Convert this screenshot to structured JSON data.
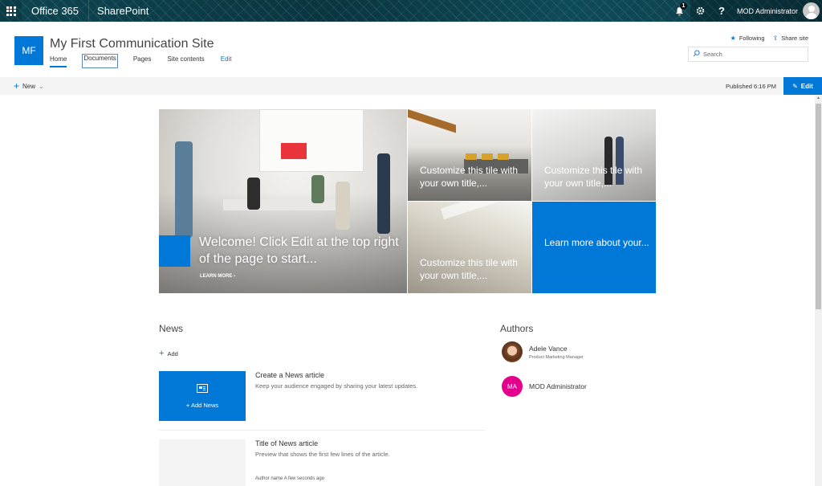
{
  "suite_bar": {
    "brand": "Office 365",
    "app": "SharePoint",
    "notifications_count": "1",
    "settings_icon": "gear-icon",
    "help_label": "?",
    "user_name": "MOD Administrator"
  },
  "site": {
    "logo_initials": "MF",
    "title": "My First Communication Site",
    "nav": [
      {
        "label": "Home",
        "active": true
      },
      {
        "label": "Documents"
      },
      {
        "label": "Pages"
      },
      {
        "label": "Site contents"
      },
      {
        "label": "Edit"
      }
    ],
    "following_label": "Following",
    "share_label": "Share site",
    "search_placeholder": "Search"
  },
  "command_bar": {
    "new_label": "New",
    "published": "Published 6:16 PM",
    "edit_label": "Edit"
  },
  "hero": {
    "main": {
      "title": "Welcome! Click Edit at the top right of the page to start...",
      "link": "LEARN MORE"
    },
    "tiles": [
      {
        "title": "Customize this tile with your own title,..."
      },
      {
        "title": "Customize this tile with your own title,..."
      },
      {
        "title": "Customize this tile with your own title,..."
      },
      {
        "title": "Learn more about your..."
      }
    ]
  },
  "news": {
    "title": "News",
    "add_label": "Add",
    "items": [
      {
        "thumb_label": "Add News",
        "headline": "Create a News article",
        "description": "Keep your audience engaged by sharing your latest updates."
      },
      {
        "headline": "Title of News article",
        "description": "Preview that shows the first few lines of the article.",
        "author": "Author name",
        "time": "A few seconds ago"
      }
    ]
  },
  "authors": {
    "title": "Authors",
    "people": [
      {
        "name": "Adele Vance",
        "role": "Product Marketing Manager"
      },
      {
        "name": "MOD Administrator",
        "initials": "MA"
      }
    ]
  },
  "colors": {
    "accent": "#0078d7",
    "suite_bar": "#0d3b47",
    "initials_avatar": "#e3008c"
  }
}
